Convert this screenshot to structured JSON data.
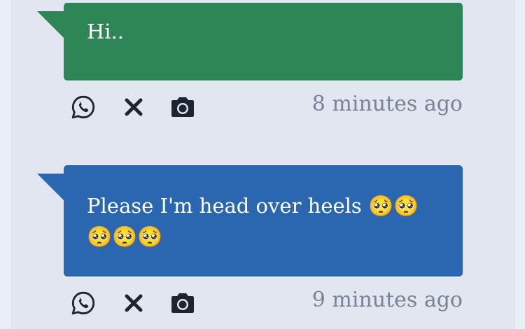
{
  "messages": [
    {
      "text": "Hi..",
      "bubble_color": "#2e8556",
      "timestamp": "8 minutes ago",
      "actions": [
        "whatsapp-icon",
        "close-icon",
        "camera-icon"
      ]
    },
    {
      "text": "Please I'm head over heels 🥺🥺🥺🥺🥺",
      "bubble_color": "#2b67b0",
      "timestamp": "9 minutes ago",
      "actions": [
        "whatsapp-icon",
        "close-icon",
        "camera-icon"
      ]
    }
  ],
  "colors": {
    "page_background": "#e2e6f0",
    "timestamp_text": "#7a8293",
    "icon": "#1f2530"
  }
}
